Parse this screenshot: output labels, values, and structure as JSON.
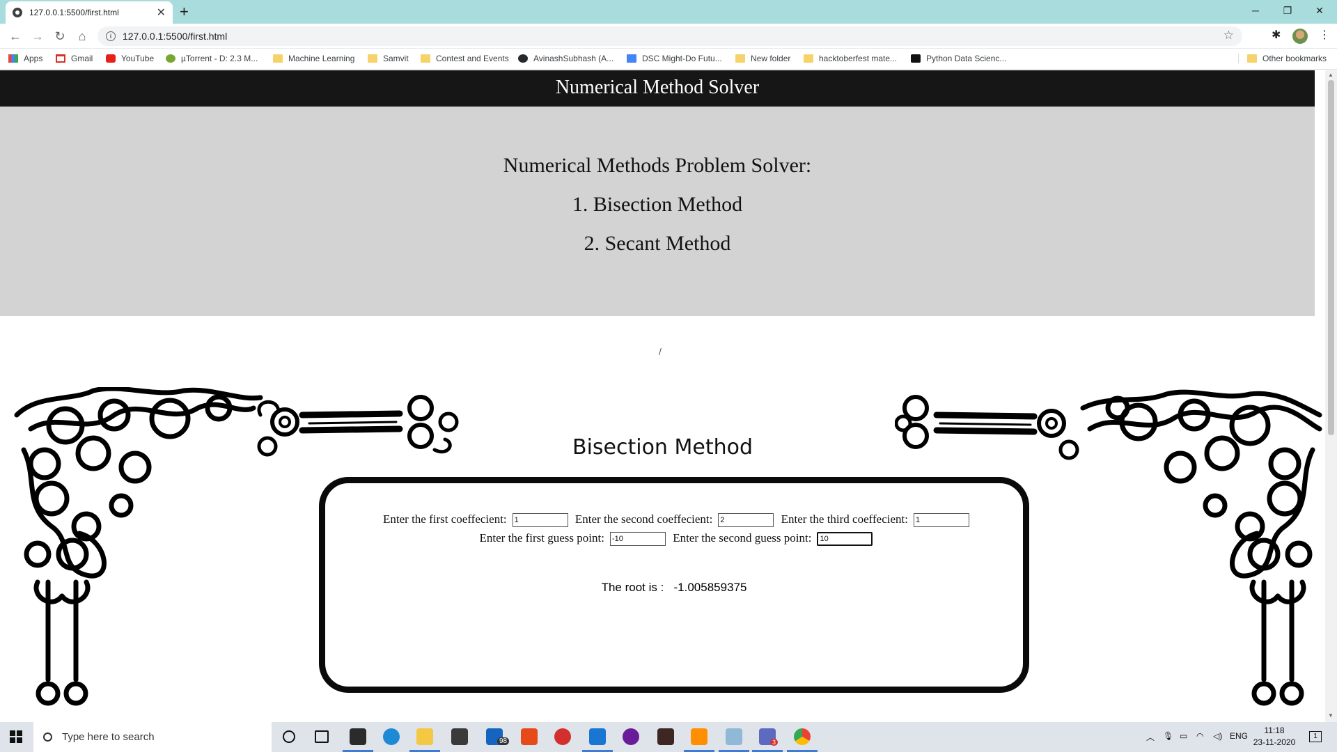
{
  "browser": {
    "tab_title": "127.0.0.1:5500/first.html",
    "url": "127.0.0.1:5500/first.html",
    "bookmarks": [
      {
        "label": "Apps",
        "icon": "apps-icon"
      },
      {
        "label": "Gmail",
        "icon": "gmail-icon"
      },
      {
        "label": "YouTube",
        "icon": "youtube-icon"
      },
      {
        "label": "µTorrent - D: 2.3 M...",
        "icon": "utorrent-icon"
      },
      {
        "label": "Machine Learning",
        "icon": "folder-icon"
      },
      {
        "label": "Samvit",
        "icon": "folder-icon"
      },
      {
        "label": "Contest and Events",
        "icon": "folder-icon"
      },
      {
        "label": "AvinashSubhash (A...",
        "icon": "github-icon"
      },
      {
        "label": "DSC Might-Do Futu...",
        "icon": "docs-icon"
      },
      {
        "label": "New folder",
        "icon": "folder-icon"
      },
      {
        "label": "hacktoberfest mate...",
        "icon": "folder-icon"
      },
      {
        "label": "Python Data Scienc...",
        "icon": "pds-icon"
      }
    ],
    "other_bookmarks": "Other bookmarks"
  },
  "page": {
    "header_title": "Numerical Method Solver",
    "intro_heading": "Numerical Methods Problem Solver:",
    "method_1": "1. Bisection Method",
    "method_2": "2. Secant Method",
    "slash_text": "/",
    "section_title": "Bisection Method",
    "form": {
      "first_coef_label": "Enter the first coeffecient:",
      "first_coef_value": "1",
      "second_coef_label": "Enter the second coeffecient:",
      "second_coef_value": "2",
      "third_coef_label": "Enter the third coeffecient:",
      "third_coef_value": "1",
      "first_guess_label": "Enter the first guess point:",
      "first_guess_value": "-10",
      "second_guess_label": "Enter the second guess point:",
      "second_guess_value": "10"
    },
    "result_label": "The root is :",
    "result_value": "-1.005859375"
  },
  "taskbar": {
    "search_placeholder": "Type here to search",
    "mail_badge": "98",
    "teams_badge": "3",
    "language": "ENG",
    "time": "11:18",
    "date": "23-11-2020",
    "notification_count": "1"
  },
  "colors": {
    "tab_strip": "#a9dcdc",
    "header_bg": "#161616",
    "intro_bg": "#d3d3d3",
    "form_border": "#0a0a0a",
    "taskbar_bg": "#dfe3ea"
  }
}
